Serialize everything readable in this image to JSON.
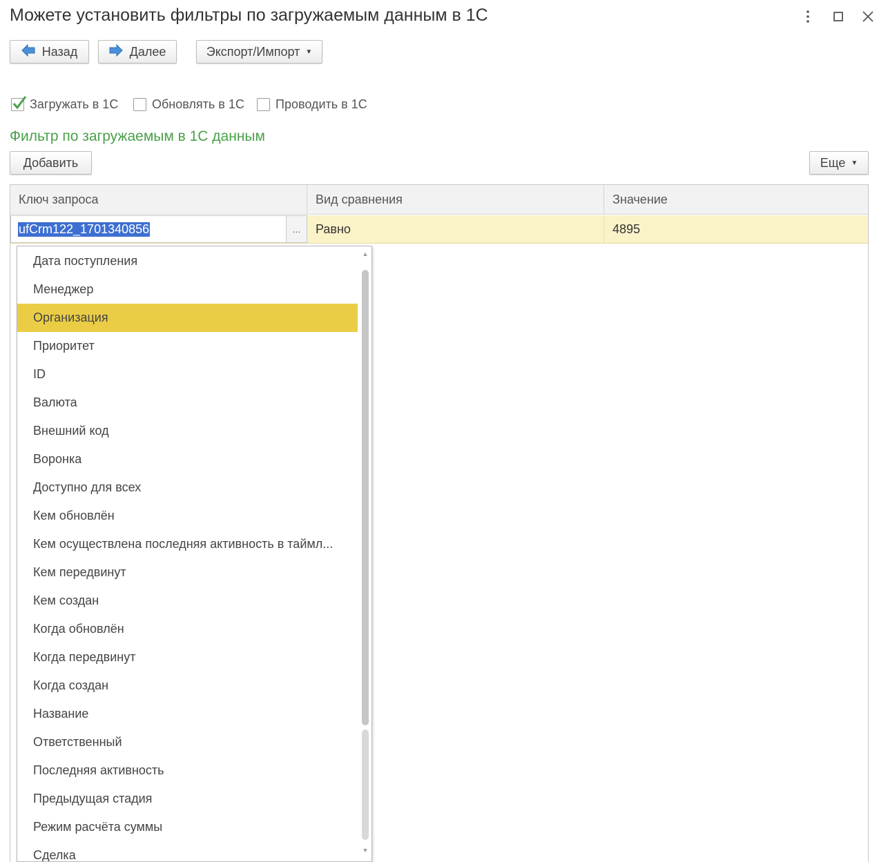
{
  "window": {
    "title": "Можете установить фильтры по загружаемым данным в 1С",
    "menu_icon": "more-vert-icon",
    "maximize_icon": "maximize-icon",
    "close_icon": "close-icon"
  },
  "toolbar": {
    "back_label": "Назад",
    "next_label": "Далее",
    "export_import_label": "Экспорт/Импорт"
  },
  "options": {
    "load": {
      "label": "Загружать в 1С",
      "checked": true
    },
    "update": {
      "label": "Обновлять в 1С",
      "checked": false
    },
    "post": {
      "label": "Проводить в 1С",
      "checked": false
    }
  },
  "filter": {
    "section_title": "Фильтр по загружаемым в 1С данным",
    "add_label": "Добавить",
    "more_label": "Еще",
    "columns": [
      "Ключ запроса",
      "Вид сравнения",
      "Значение"
    ],
    "row": {
      "key": "ufCrm122_1701340856",
      "choose_button": "...",
      "comparison": "Равно",
      "value": "4895"
    }
  },
  "dropdown": {
    "selected": "Организация",
    "items": [
      "Дата поступления",
      "Менеджер",
      "Организация",
      "Приоритет",
      "ID",
      "Валюта",
      "Внешний код",
      "Воронка",
      "Доступно для всех",
      "Кем обновлён",
      "Кем осуществлена последняя активность в таймл...",
      "Кем передвинут",
      "Кем создан",
      "Когда обновлён",
      "Когда передвинут",
      "Когда создан",
      "Название",
      "Ответственный",
      "Последняя активность",
      "Предыдущая стадия",
      "Режим расчёта суммы",
      "Сделка"
    ]
  },
  "colors": {
    "accent_green": "#4aa04a",
    "selected_item": "#ebcd45",
    "current_row": "#fbf3c8",
    "nav_arrow": "#4a90d9"
  }
}
